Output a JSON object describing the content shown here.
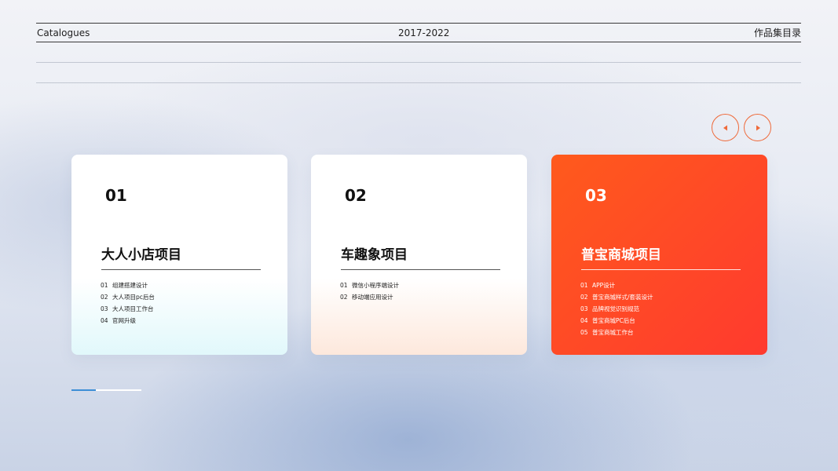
{
  "header": {
    "left": "Catalogues",
    "center": "2017-2022",
    "right": "作品集目录"
  },
  "nav": {
    "prev_icon": "caret-left-icon",
    "next_icon": "caret-right-icon",
    "accent": "#ef6a3a"
  },
  "cards": [
    {
      "number": "01",
      "title": "大人小店项目",
      "items": [
        {
          "idx": "01",
          "text": "组建搭建设计"
        },
        {
          "idx": "02",
          "text": "大人项目pc后台"
        },
        {
          "idx": "03",
          "text": "大人项目工作台"
        },
        {
          "idx": "04",
          "text": "官网升级"
        }
      ]
    },
    {
      "number": "02",
      "title": "车趣象项目",
      "items": [
        {
          "idx": "01",
          "text": "微信小程序端设计"
        },
        {
          "idx": "02",
          "text": "移动端应用设计"
        }
      ]
    },
    {
      "number": "03",
      "title": "普宝商城项目",
      "highlight_color": "#ff4a26",
      "items": [
        {
          "idx": "01",
          "text": "APP设计"
        },
        {
          "idx": "02",
          "text": "普宝商城样式/套装设计"
        },
        {
          "idx": "03",
          "text": "品牌视觉识别规范"
        },
        {
          "idx": "04",
          "text": "普宝商城PC后台"
        },
        {
          "idx": "05",
          "text": "普宝商城工作台"
        }
      ]
    }
  ],
  "progress": {
    "fraction": 0.35,
    "color": "#3d8fd6"
  }
}
